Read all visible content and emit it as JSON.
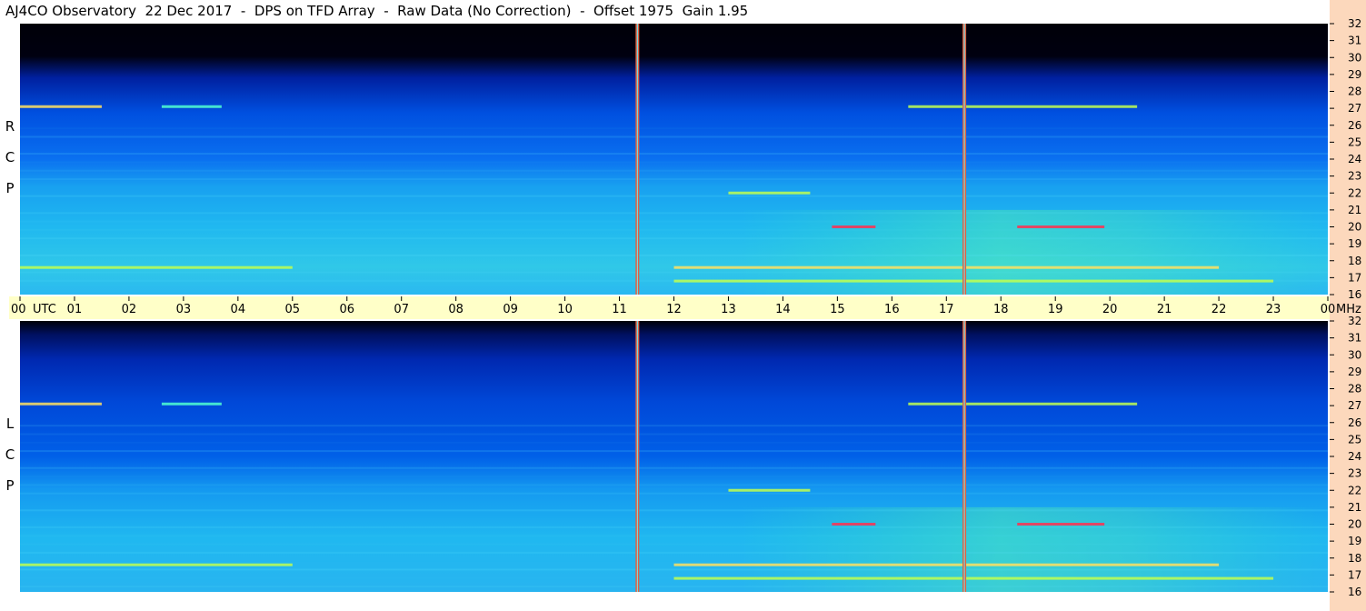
{
  "title": "AJ4CO Observatory  22 Dec 2017  -  DPS on TFD Array  -  Raw Data (No Correction)  -  Offset 1975  Gain 1.95",
  "colors": {
    "background_dark": "#000010",
    "low": "#0030c0",
    "mid": "#1a8cff",
    "high": "#33d6e6",
    "hot": "#d7ff40",
    "peak": "#ff4060",
    "axis_bg": "#ffffc8",
    "right_strip": "#fcd8bc",
    "vline": "#e06040"
  },
  "chart_data": {
    "type": "heatmap",
    "x_unit_label": "UTC",
    "y_unit_label": "MHz",
    "time_ticks": [
      "00",
      "01",
      "02",
      "03",
      "04",
      "05",
      "06",
      "07",
      "08",
      "09",
      "10",
      "11",
      "12",
      "13",
      "14",
      "15",
      "16",
      "17",
      "18",
      "19",
      "20",
      "21",
      "22",
      "23",
      "00"
    ],
    "freq_ticks": [
      "32",
      "31",
      "30",
      "29",
      "28",
      "27",
      "26",
      "25",
      "24",
      "23",
      "22",
      "21",
      "20",
      "19",
      "18",
      "17",
      "16"
    ],
    "xlim_hours": [
      0,
      24
    ],
    "ylim_mhz": [
      16,
      32
    ],
    "panels": [
      {
        "label": [
          "R",
          "C",
          "P"
        ]
      },
      {
        "label": [
          "L",
          "C",
          "P"
        ]
      }
    ],
    "vertical_lines_hours": [
      11.33,
      17.33
    ],
    "emission_features": [
      {
        "f_mhz": 27.1,
        "t_start": 0.0,
        "t_end": 1.5,
        "intensity": 0.85
      },
      {
        "f_mhz": 27.1,
        "t_start": 2.6,
        "t_end": 3.7,
        "intensity": 0.6
      },
      {
        "f_mhz": 27.1,
        "t_start": 16.3,
        "t_end": 20.5,
        "intensity": 0.75
      },
      {
        "f_mhz": 17.6,
        "t_start": 0.0,
        "t_end": 5.0,
        "intensity": 0.7
      },
      {
        "f_mhz": 17.6,
        "t_start": 12.0,
        "t_end": 22.0,
        "intensity": 0.9
      },
      {
        "f_mhz": 20.0,
        "t_start": 14.9,
        "t_end": 15.7,
        "intensity": 0.95
      },
      {
        "f_mhz": 20.0,
        "t_start": 18.3,
        "t_end": 19.9,
        "intensity": 0.95
      },
      {
        "f_mhz": 22.0,
        "t_start": 13.0,
        "t_end": 14.5,
        "intensity": 0.7
      },
      {
        "f_mhz": 16.8,
        "t_start": 12.0,
        "t_end": 23.0,
        "intensity": 0.7
      }
    ]
  }
}
